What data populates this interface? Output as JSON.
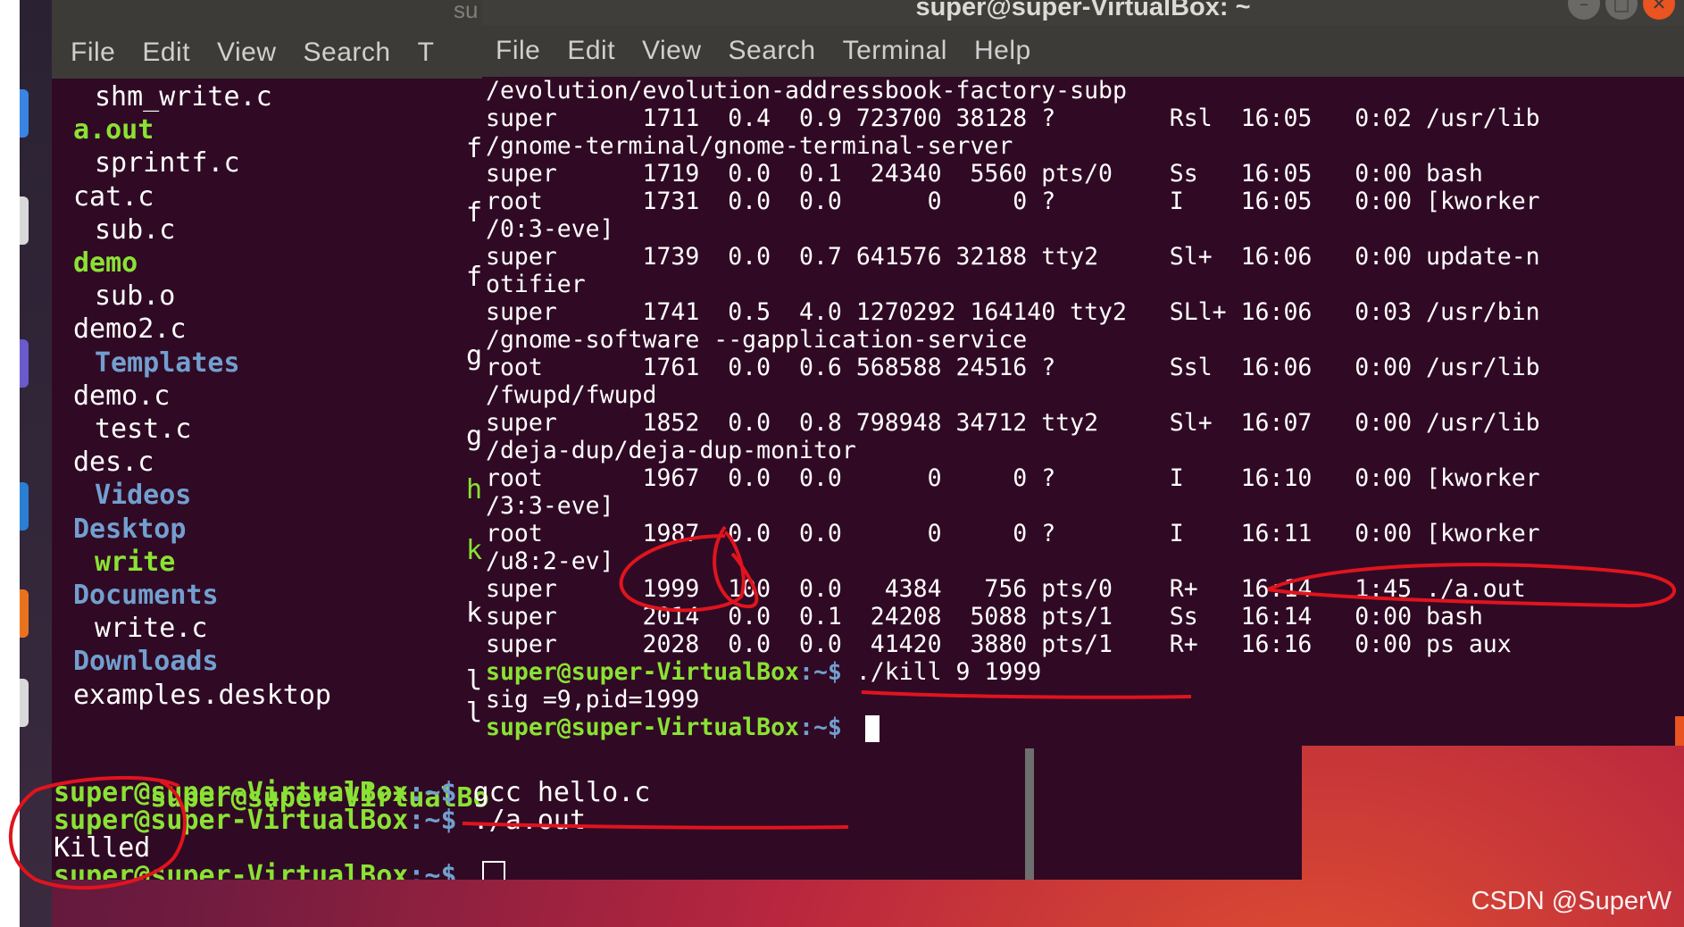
{
  "back_terminal": {
    "title": "su",
    "menu": [
      "File",
      "Edit",
      "View",
      "Search",
      "T"
    ],
    "listing": [
      {
        "text": "shm_write.c",
        "kind": "file",
        "indent": true
      },
      {
        "text": "a.out",
        "kind": "exec",
        "indent": false
      },
      {
        "text": "sprintf.c",
        "kind": "file",
        "indent": true
      },
      {
        "text": "cat.c",
        "kind": "file",
        "indent": false
      },
      {
        "text": "sub.c",
        "kind": "file",
        "indent": true
      },
      {
        "text": "demo",
        "kind": "exec",
        "indent": false
      },
      {
        "text": "sub.o",
        "kind": "file",
        "indent": true
      },
      {
        "text": "demo2.c",
        "kind": "file",
        "indent": false
      },
      {
        "text": "Templates",
        "kind": "dir",
        "indent": true
      },
      {
        "text": "demo.c",
        "kind": "file",
        "indent": false
      },
      {
        "text": "test.c",
        "kind": "file",
        "indent": true
      },
      {
        "text": "des.c",
        "kind": "file",
        "indent": false
      },
      {
        "text": "Videos",
        "kind": "dir",
        "indent": true
      },
      {
        "text": "Desktop",
        "kind": "dir",
        "indent": false
      },
      {
        "text": "write",
        "kind": "exec",
        "indent": true
      },
      {
        "text": "Documents",
        "kind": "dir",
        "indent": false
      },
      {
        "text": "write.c",
        "kind": "file",
        "indent": true
      },
      {
        "text": "Downloads",
        "kind": "dir",
        "indent": false
      },
      {
        "text": "examples.desktop",
        "kind": "file",
        "indent": false
      }
    ],
    "partial_prompt": "super@super-VirtualBo",
    "prompt_user": "super@super-VirtualBox",
    "prompt_path": ":~$ ",
    "commands": [
      "gcc hello.c",
      "./a.out"
    ],
    "output": "Killed"
  },
  "front_terminal": {
    "title": "super@super-VirtualBox: ~",
    "menu": [
      "File",
      "Edit",
      "View",
      "Search",
      "Terminal",
      "Help"
    ],
    "lines": [
      "/evolution/evolution-addressbook-factory-subp",
      "super      1711  0.4  0.9 723700 38128 ?        Rsl  16:05   0:02 /usr/lib",
      "/gnome-terminal/gnome-terminal-server",
      "super      1719  0.0  0.1  24340  5560 pts/0    Ss   16:05   0:00 bash",
      "root       1731  0.0  0.0      0     0 ?        I    16:05   0:00 [kworker",
      "/0:3-eve]",
      "super      1739  0.0  0.7 641576 32188 tty2     Sl+  16:06   0:00 update-n",
      "otifier",
      "super      1741  0.5  4.0 1270292 164140 tty2   SLl+ 16:06   0:03 /usr/bin",
      "/gnome-software --gapplication-service",
      "root       1761  0.0  0.6 568588 24516 ?        Ssl  16:06   0:00 /usr/lib",
      "/fwupd/fwupd",
      "super      1852  0.0  0.8 798948 34712 tty2     Sl+  16:07   0:00 /usr/lib",
      "/deja-dup/deja-dup-monitor",
      "root       1967  0.0  0.0      0     0 ?        I    16:10   0:00 [kworker",
      "/3:3-eve]",
      "root       1987  0.0  0.0      0     0 ?        I    16:11   0:00 [kworker",
      "/u8:2-ev]",
      "super      1999  100  0.0   4384   756 pts/0    R+   16:14   1:45 ./a.out",
      "super      2014  0.0  0.1  24208  5088 pts/1    Ss   16:14   0:00 bash",
      "super      2028  0.0  0.0  41420  3880 pts/1    R+   16:16   0:00 ps aux"
    ],
    "prompt_user": "super@super-VirtualBox",
    "prompt_path": ":~$ ",
    "command": "./kill 9 1999",
    "output": "sig =9,pid=1999"
  },
  "overlap_prefixes": [
    "f",
    "f",
    "f",
    "g",
    "g",
    "h",
    "k",
    "k",
    "l",
    "l"
  ],
  "watermark": "CSDN @SuperW",
  "colors": {
    "terminal_bg": "#300a24",
    "menubar_bg": "#3c3b37",
    "prompt_user": "#8ae234",
    "prompt_path": "#729fcf",
    "annotation": "#e0141e",
    "close_button": "#e95420"
  }
}
